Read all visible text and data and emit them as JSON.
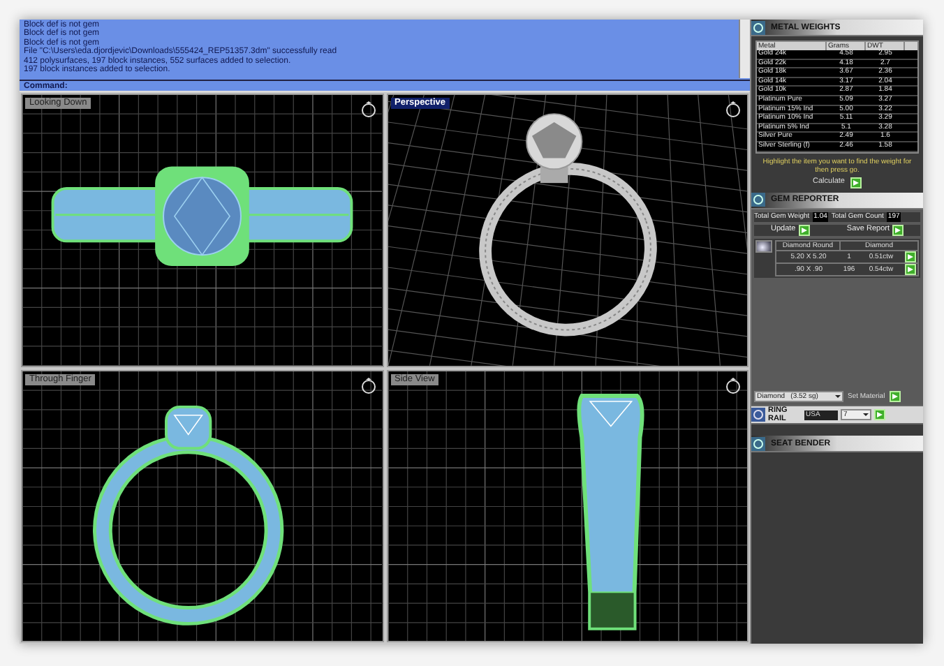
{
  "command_log": {
    "lines": [
      "Block def is not gem",
      "Block def is not gem",
      "Block def is not gem",
      "File \"C:\\Users\\eda.djordjevic\\Downloads\\555424_REP51357.3dm\" successfully read",
      "412 polysurfaces, 197 block instances, 552 surfaces added to selection.",
      "197 block instances added to selection."
    ],
    "prompt": "Command:"
  },
  "viewports": [
    {
      "title": "Looking Down",
      "kind": "top",
      "selected": false
    },
    {
      "title": "Perspective",
      "kind": "perspective",
      "selected": true
    },
    {
      "title": "Through Finger",
      "kind": "front",
      "selected": false
    },
    {
      "title": "Side View",
      "kind": "side",
      "selected": false
    }
  ],
  "metal_weights": {
    "title": "METAL WEIGHTS",
    "columns": [
      "Metal",
      "Grams",
      "DWT"
    ],
    "rows": [
      [
        "Gold 24k",
        "4.58",
        "2.95"
      ],
      [
        "Gold 22k",
        "4.18",
        "2.7"
      ],
      [
        "Gold 18k",
        "3.67",
        "2.36"
      ],
      [
        "Gold 14k",
        "3.17",
        "2.04"
      ],
      [
        "Gold 10k",
        "2.87",
        "1.84"
      ],
      [
        "Platinum Pure",
        "5.09",
        "3.27"
      ],
      [
        "Platinum 15% Ind",
        "5.00",
        "3.22"
      ],
      [
        "Platinum 10% Ind",
        "5.11",
        "3.29"
      ],
      [
        "Platinum 5% Ind",
        "5.1",
        "3.28"
      ],
      [
        "Silver Pure",
        "2.49",
        "1.6"
      ],
      [
        "Silver Sterling (f)",
        "2.46",
        "1.58"
      ]
    ],
    "hint": "Highlight the item you want to find the weight for then press go.",
    "calculate": "Calculate"
  },
  "gem_reporter": {
    "title": "GEM REPORTER",
    "total_weight_label": "Total Gem Weight",
    "total_weight": "1.04",
    "total_count_label": "Total Gem Count",
    "total_count": "197",
    "update": "Update",
    "save_report": "Save Report",
    "gem_shape": "Diamond Round",
    "gem_material": "Diamond",
    "rows": [
      [
        "5.20 X 5.20",
        "1",
        "0.51ctw"
      ],
      [
        ".90 X .90",
        "196",
        "0.54ctw"
      ]
    ],
    "material": "Diamond   (3.52 sg)",
    "set_material": "Set Material"
  },
  "ring_rail": {
    "title": "RING RAIL",
    "standard": "USA",
    "size": "7"
  },
  "seat_bender": {
    "title": "SEAT BENDER"
  }
}
